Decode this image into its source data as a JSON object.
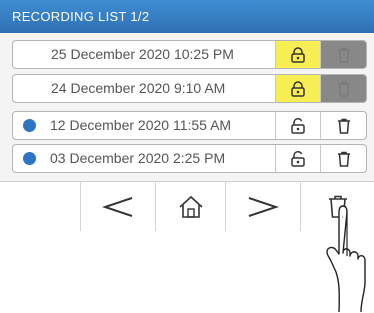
{
  "header": {
    "title": "RECORDING LIST 1/2"
  },
  "recordings": [
    {
      "label": "25 December 2020 10:25 PM",
      "unread": false,
      "locked": true
    },
    {
      "label": "24 December 2020 9:10 AM",
      "unread": false,
      "locked": true
    },
    {
      "label": "12 December 2020 11:55 AM",
      "unread": true,
      "locked": false
    },
    {
      "label": "03 December 2020 2:25 PM",
      "unread": true,
      "locked": false
    }
  ],
  "toolbar": {
    "prev_icon": "chevron-left-icon",
    "home_icon": "home-icon",
    "next_icon": "chevron-right-icon",
    "delete_icon": "trash-icon"
  },
  "colors": {
    "header": "#3a82c8",
    "lock_active": "#f6ee52",
    "delete_disabled": "#888888",
    "unread_dot": "#2f74c4"
  }
}
